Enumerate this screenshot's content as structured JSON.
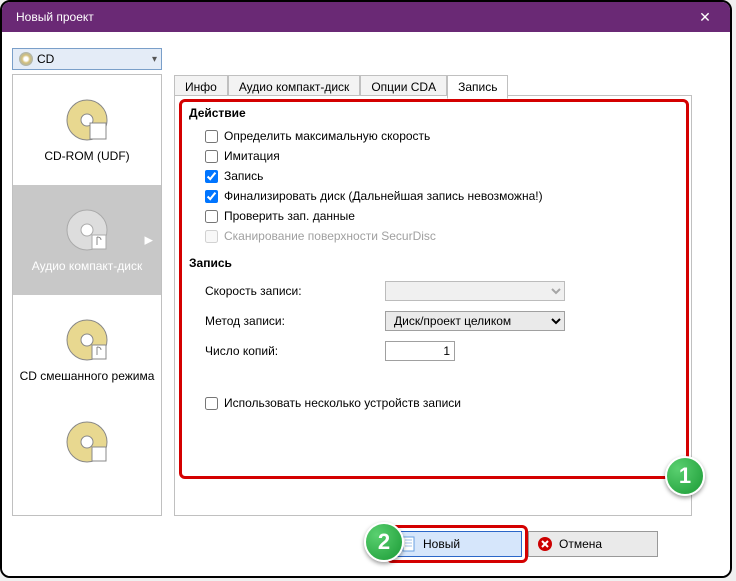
{
  "window": {
    "title": "Новый проект"
  },
  "disctype": {
    "label": "CD"
  },
  "projects": {
    "cdrom_udf": "CD-ROM (UDF)",
    "audio_cd": "Аудио компакт-диск",
    "mixed_cd": "CD смешанного режима"
  },
  "tabs": {
    "info": "Инфо",
    "audio_cd": "Аудио компакт-диск",
    "cda_options": "Опции CDA",
    "write": "Запись"
  },
  "action": {
    "title": "Действие",
    "detect_max_speed": "Определить максимальную скорость",
    "simulation": "Имитация",
    "write": "Запись",
    "finalize": "Финализировать диск (Дальнейшая запись невозможна!)",
    "verify": "Проверить зап. данные",
    "surface_scan": "Сканирование поверхности SecurDisc"
  },
  "write_section": {
    "title": "Запись",
    "speed_label": "Скорость записи:",
    "method_label": "Метод записи:",
    "method_value": "Диск/проект целиком",
    "copies_label": "Число копий:",
    "copies_value": "1",
    "multi_device": "Использовать несколько устройств записи"
  },
  "buttons": {
    "new": "Новый",
    "cancel": "Отмена"
  },
  "badges": {
    "one": "1",
    "two": "2"
  }
}
